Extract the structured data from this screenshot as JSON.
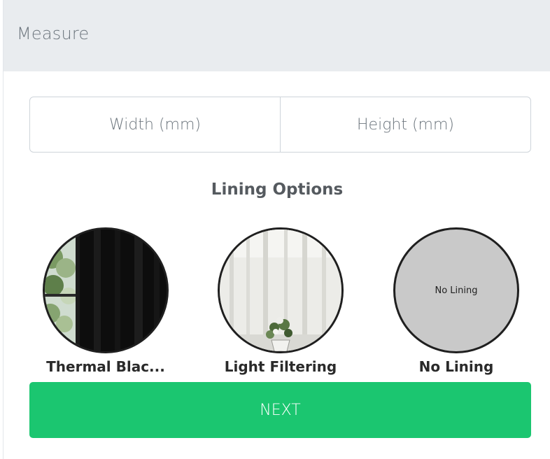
{
  "header": {
    "title": "Measure"
  },
  "dimensions": {
    "width_placeholder": "Width (mm)",
    "height_placeholder": "Height (mm)",
    "width_value": "",
    "height_value": ""
  },
  "lining": {
    "title": "Lining Options",
    "options": [
      {
        "label": "Thermal Blac...",
        "image": "thermal-blackout-curtain-photo"
      },
      {
        "label": "Light Filtering",
        "image": "light-filtering-curtain-photo"
      },
      {
        "label": "No Lining",
        "image_text": "No Lining"
      }
    ]
  },
  "actions": {
    "next_label": "NEXT"
  },
  "colors": {
    "accent": "#1bc670",
    "header_bg": "#e9ecef"
  }
}
